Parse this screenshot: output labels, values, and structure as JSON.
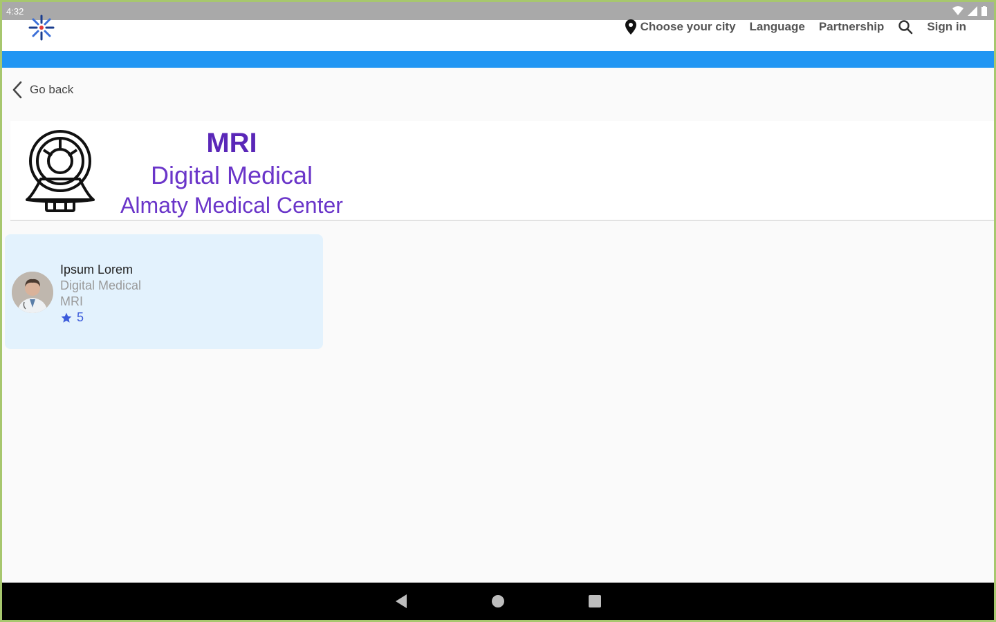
{
  "status": {
    "time": "4:32"
  },
  "nav": {
    "city": "Choose your city",
    "language": "Language",
    "partnership": "Partnership",
    "signin": "Sign in"
  },
  "goback": {
    "label": "Go back"
  },
  "header": {
    "title": "MRI",
    "subtitle": "Digital Medical",
    "center": "Almaty Medical Center"
  },
  "doctor": {
    "name": "Ipsum  Lorem",
    "clinic": "Digital Medical",
    "specialty": "MRI",
    "rating": "5"
  },
  "colors": {
    "accent_blue": "#2196f3",
    "title_purple": "#6a35c9",
    "card_bg": "#e3f2fd"
  }
}
